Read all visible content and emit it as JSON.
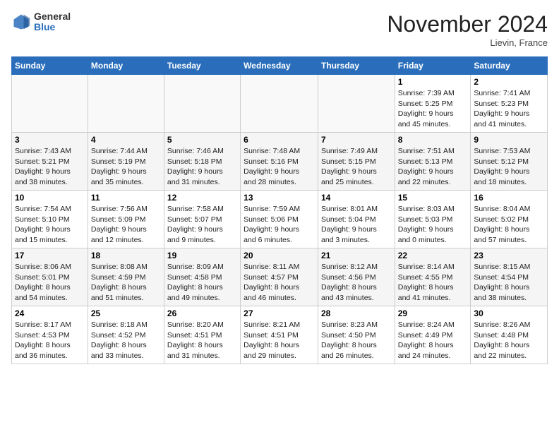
{
  "header": {
    "logo_general": "General",
    "logo_blue": "Blue",
    "month_title": "November 2024",
    "location": "Lievin, France"
  },
  "days_of_week": [
    "Sunday",
    "Monday",
    "Tuesday",
    "Wednesday",
    "Thursday",
    "Friday",
    "Saturday"
  ],
  "weeks": [
    [
      {
        "day": "",
        "info": ""
      },
      {
        "day": "",
        "info": ""
      },
      {
        "day": "",
        "info": ""
      },
      {
        "day": "",
        "info": ""
      },
      {
        "day": "",
        "info": ""
      },
      {
        "day": "1",
        "info": "Sunrise: 7:39 AM\nSunset: 5:25 PM\nDaylight: 9 hours\nand 45 minutes."
      },
      {
        "day": "2",
        "info": "Sunrise: 7:41 AM\nSunset: 5:23 PM\nDaylight: 9 hours\nand 41 minutes."
      }
    ],
    [
      {
        "day": "3",
        "info": "Sunrise: 7:43 AM\nSunset: 5:21 PM\nDaylight: 9 hours\nand 38 minutes."
      },
      {
        "day": "4",
        "info": "Sunrise: 7:44 AM\nSunset: 5:19 PM\nDaylight: 9 hours\nand 35 minutes."
      },
      {
        "day": "5",
        "info": "Sunrise: 7:46 AM\nSunset: 5:18 PM\nDaylight: 9 hours\nand 31 minutes."
      },
      {
        "day": "6",
        "info": "Sunrise: 7:48 AM\nSunset: 5:16 PM\nDaylight: 9 hours\nand 28 minutes."
      },
      {
        "day": "7",
        "info": "Sunrise: 7:49 AM\nSunset: 5:15 PM\nDaylight: 9 hours\nand 25 minutes."
      },
      {
        "day": "8",
        "info": "Sunrise: 7:51 AM\nSunset: 5:13 PM\nDaylight: 9 hours\nand 22 minutes."
      },
      {
        "day": "9",
        "info": "Sunrise: 7:53 AM\nSunset: 5:12 PM\nDaylight: 9 hours\nand 18 minutes."
      }
    ],
    [
      {
        "day": "10",
        "info": "Sunrise: 7:54 AM\nSunset: 5:10 PM\nDaylight: 9 hours\nand 15 minutes."
      },
      {
        "day": "11",
        "info": "Sunrise: 7:56 AM\nSunset: 5:09 PM\nDaylight: 9 hours\nand 12 minutes."
      },
      {
        "day": "12",
        "info": "Sunrise: 7:58 AM\nSunset: 5:07 PM\nDaylight: 9 hours\nand 9 minutes."
      },
      {
        "day": "13",
        "info": "Sunrise: 7:59 AM\nSunset: 5:06 PM\nDaylight: 9 hours\nand 6 minutes."
      },
      {
        "day": "14",
        "info": "Sunrise: 8:01 AM\nSunset: 5:04 PM\nDaylight: 9 hours\nand 3 minutes."
      },
      {
        "day": "15",
        "info": "Sunrise: 8:03 AM\nSunset: 5:03 PM\nDaylight: 9 hours\nand 0 minutes."
      },
      {
        "day": "16",
        "info": "Sunrise: 8:04 AM\nSunset: 5:02 PM\nDaylight: 8 hours\nand 57 minutes."
      }
    ],
    [
      {
        "day": "17",
        "info": "Sunrise: 8:06 AM\nSunset: 5:01 PM\nDaylight: 8 hours\nand 54 minutes."
      },
      {
        "day": "18",
        "info": "Sunrise: 8:08 AM\nSunset: 4:59 PM\nDaylight: 8 hours\nand 51 minutes."
      },
      {
        "day": "19",
        "info": "Sunrise: 8:09 AM\nSunset: 4:58 PM\nDaylight: 8 hours\nand 49 minutes."
      },
      {
        "day": "20",
        "info": "Sunrise: 8:11 AM\nSunset: 4:57 PM\nDaylight: 8 hours\nand 46 minutes."
      },
      {
        "day": "21",
        "info": "Sunrise: 8:12 AM\nSunset: 4:56 PM\nDaylight: 8 hours\nand 43 minutes."
      },
      {
        "day": "22",
        "info": "Sunrise: 8:14 AM\nSunset: 4:55 PM\nDaylight: 8 hours\nand 41 minutes."
      },
      {
        "day": "23",
        "info": "Sunrise: 8:15 AM\nSunset: 4:54 PM\nDaylight: 8 hours\nand 38 minutes."
      }
    ],
    [
      {
        "day": "24",
        "info": "Sunrise: 8:17 AM\nSunset: 4:53 PM\nDaylight: 8 hours\nand 36 minutes."
      },
      {
        "day": "25",
        "info": "Sunrise: 8:18 AM\nSunset: 4:52 PM\nDaylight: 8 hours\nand 33 minutes."
      },
      {
        "day": "26",
        "info": "Sunrise: 8:20 AM\nSunset: 4:51 PM\nDaylight: 8 hours\nand 31 minutes."
      },
      {
        "day": "27",
        "info": "Sunrise: 8:21 AM\nSunset: 4:51 PM\nDaylight: 8 hours\nand 29 minutes."
      },
      {
        "day": "28",
        "info": "Sunrise: 8:23 AM\nSunset: 4:50 PM\nDaylight: 8 hours\nand 26 minutes."
      },
      {
        "day": "29",
        "info": "Sunrise: 8:24 AM\nSunset: 4:49 PM\nDaylight: 8 hours\nand 24 minutes."
      },
      {
        "day": "30",
        "info": "Sunrise: 8:26 AM\nSunset: 4:48 PM\nDaylight: 8 hours\nand 22 minutes."
      }
    ]
  ]
}
